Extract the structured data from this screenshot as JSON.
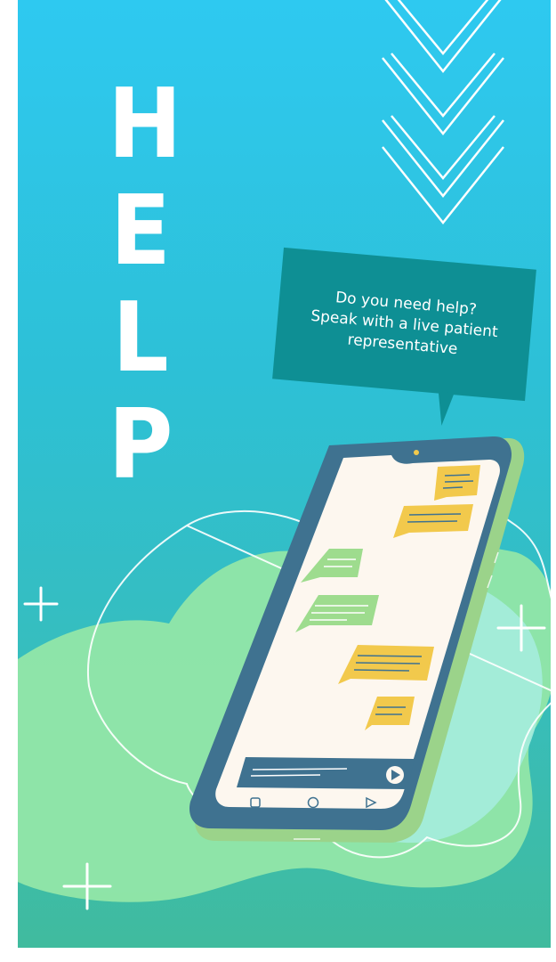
{
  "poster": {
    "letters": [
      "H",
      "E",
      "L",
      "P"
    ],
    "bubble_text": "Do you need help?\nSpeak with a live patient\nrepresentative"
  },
  "icons": {
    "chevrons": "chevron-down-icon",
    "sparkles": "plus-sparkle-icon",
    "send": "send-arrow-icon",
    "nav": [
      "square-nav-icon",
      "circle-nav-icon",
      "triangle-nav-icon"
    ]
  },
  "colors": {
    "background_top": "#2ec9f0",
    "background_bottom": "#40bb9e",
    "bubble": "#0e8f94",
    "phone_frame": "#3f7290",
    "screen": "#fdf7ef",
    "message_yellow": "#f2c94c",
    "message_green": "#9edc8e"
  }
}
